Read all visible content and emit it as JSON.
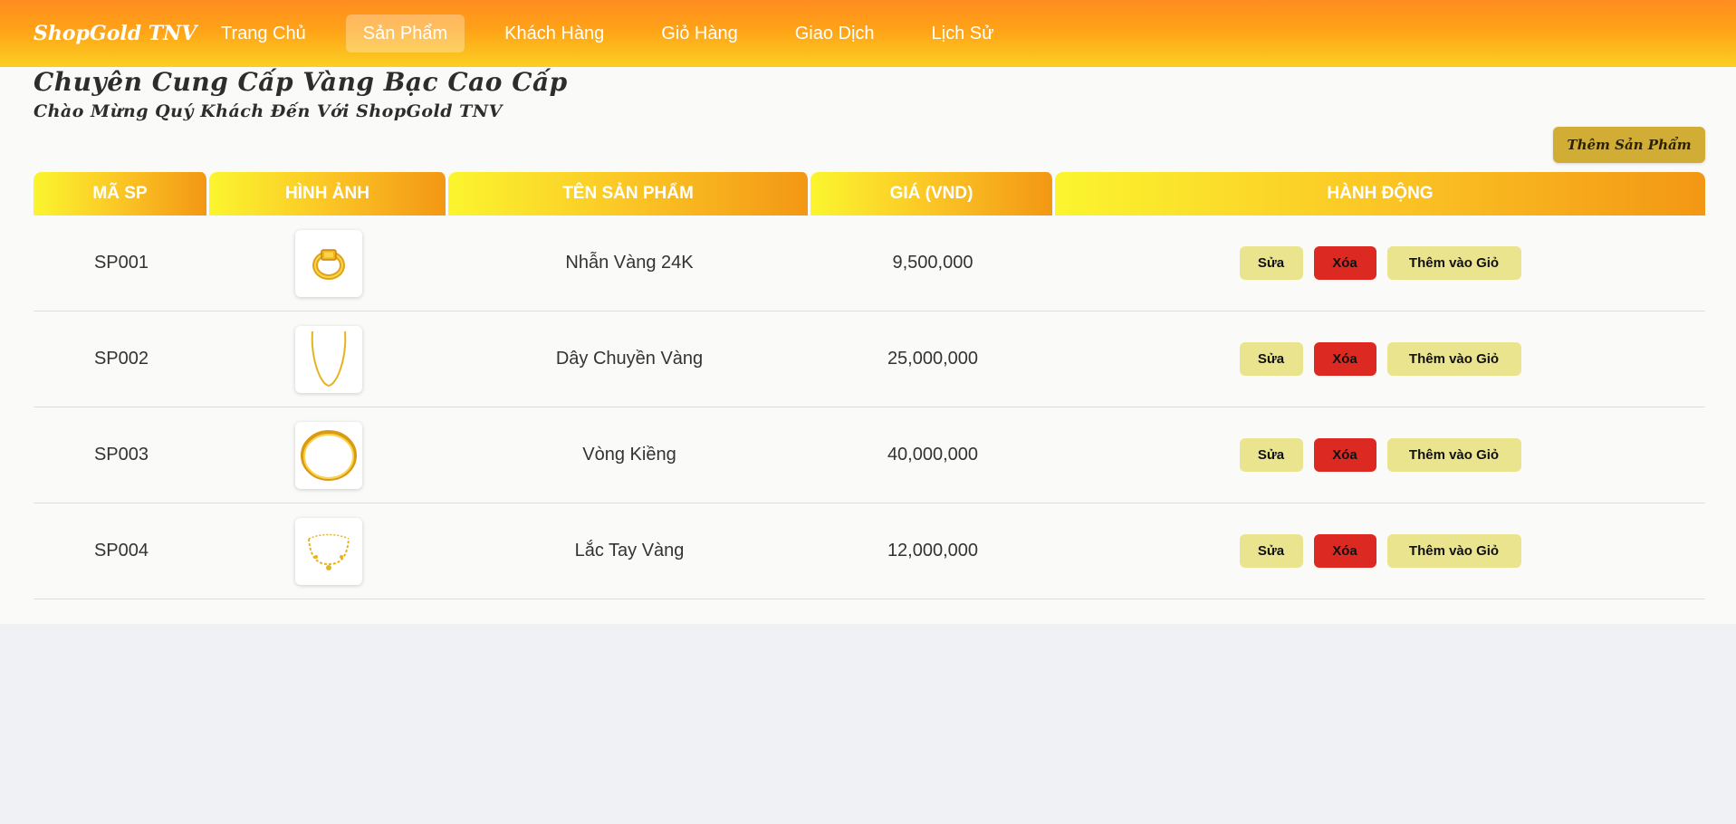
{
  "brand": "ShopGold TNV",
  "nav": [
    {
      "label": "Trang Chủ",
      "active": false
    },
    {
      "label": "Sản Phẩm",
      "active": true
    },
    {
      "label": "Khách Hàng",
      "active": false
    },
    {
      "label": "Giỏ Hàng",
      "active": false
    },
    {
      "label": "Giao Dịch",
      "active": false
    },
    {
      "label": "Lịch Sử",
      "active": false
    }
  ],
  "page": {
    "headline": "Chuyên Cung Cấp Vàng Bạc Cao Cấp",
    "subheadline": "Chào Mừng Quý Khách Đến Với ShopGold TNV",
    "add_product_label": "Thêm Sản Phẩm"
  },
  "table": {
    "columns": [
      "MÃ SP",
      "HÌNH ẢNH",
      "TÊN SẢN PHẨM",
      "GIÁ (VND)",
      "HÀNH ĐỘNG"
    ],
    "rows": [
      {
        "code": "SP001",
        "name": "Nhẫn Vàng 24K",
        "price": "9,500,000",
        "image_icon": "gold-ring-icon"
      },
      {
        "code": "SP002",
        "name": "Dây Chuyền Vàng",
        "price": "25,000,000",
        "image_icon": "gold-necklace-icon"
      },
      {
        "code": "SP003",
        "name": "Vòng Kiềng",
        "price": "40,000,000",
        "image_icon": "gold-bangle-icon"
      },
      {
        "code": "SP004",
        "name": "Lắc Tay Vàng",
        "price": "12,000,000",
        "image_icon": "gold-bracelet-icon"
      }
    ],
    "actions": {
      "edit": "Sửa",
      "delete": "Xóa",
      "add_to_cart": "Thêm vào Giỏ"
    }
  },
  "colors": {
    "nav_gradient_top": "#ff8c1f",
    "nav_gradient_bottom": "#fbcf22",
    "header_gold": "#fbc625",
    "add_button": "#d2ad35",
    "edit_button": "#ebe48f",
    "delete_button": "#dc2a23"
  }
}
